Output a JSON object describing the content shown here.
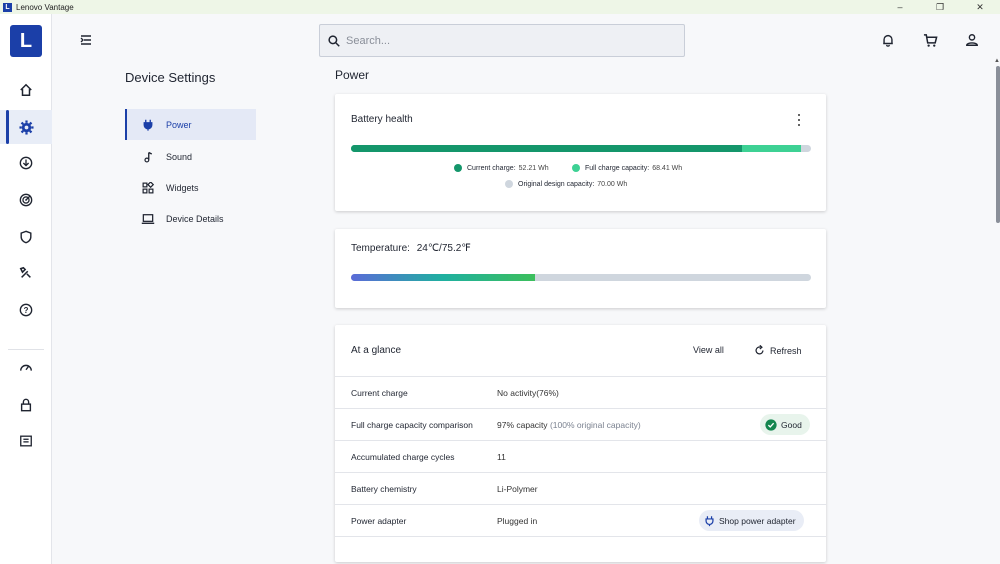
{
  "window": {
    "title": "Lenovo Vantage",
    "app_icon_letter": "L",
    "controls": {
      "minimize": "–",
      "restore": "❐",
      "close": "✕"
    }
  },
  "rail": {
    "logo_letter": "L",
    "items": [
      {
        "name": "home",
        "icon": "home-icon",
        "active": false
      },
      {
        "name": "device-settings",
        "icon": "gear-icon",
        "active": true
      },
      {
        "name": "downloads",
        "icon": "download-icon",
        "active": false
      },
      {
        "name": "radar",
        "icon": "radar-icon",
        "active": false
      },
      {
        "name": "security",
        "icon": "shield-icon",
        "active": false
      },
      {
        "name": "tools",
        "icon": "tools-icon",
        "active": false
      },
      {
        "name": "help",
        "icon": "help-icon",
        "active": false
      },
      {
        "name": "performance",
        "icon": "speedometer-icon",
        "active": false
      },
      {
        "name": "lock",
        "icon": "lock-icon",
        "active": false
      },
      {
        "name": "dashboard",
        "icon": "dashboard-icon",
        "active": false
      }
    ]
  },
  "search": {
    "placeholder": "Search..."
  },
  "header_icons": [
    "bell-icon",
    "cart-icon",
    "user-icon"
  ],
  "device_settings": {
    "title": "Device Settings",
    "items": [
      {
        "label": "Power",
        "icon": "plug-icon",
        "active": true
      },
      {
        "label": "Sound",
        "icon": "music-note-icon",
        "active": false
      },
      {
        "label": "Widgets",
        "icon": "widgets-icon",
        "active": false
      },
      {
        "label": "Device Details",
        "icon": "laptop-icon",
        "active": false
      }
    ]
  },
  "power": {
    "title": "Power",
    "battery_health": {
      "title": "Battery health",
      "current_charge_label": "Current charge:",
      "current_charge_value": "52.21 Wh",
      "full_charge_label": "Full charge capacity:",
      "full_charge_value": "68.41 Wh",
      "design_label": "Original design capacity:",
      "design_value": "70.00 Wh",
      "current_wh": 52.21,
      "full_wh": 68.41,
      "design_wh": 70.0,
      "colors": {
        "current": "#14966b",
        "full": "#3dd194",
        "design": "#cfd6de"
      }
    },
    "temperature": {
      "label": "Temperature:",
      "value": "24℃/75.2℉",
      "level_fraction": 0.4
    },
    "at_a_glance": {
      "title": "At a glance",
      "view_all": "View all",
      "refresh": "Refresh",
      "rows": [
        {
          "key": "Current charge",
          "value": "No activity(76%)",
          "muted": ""
        },
        {
          "key": "Full charge capacity comparison",
          "value": "97% capacity",
          "muted": "(100% original capacity)",
          "badge": "Good"
        },
        {
          "key": "Accumulated charge cycles",
          "value": "11",
          "muted": ""
        },
        {
          "key": "Battery chemistry",
          "value": "Li-Polymer",
          "muted": ""
        },
        {
          "key": "Power adapter",
          "value": "Plugged in",
          "muted": "",
          "action": "Shop power adapter"
        }
      ]
    }
  }
}
